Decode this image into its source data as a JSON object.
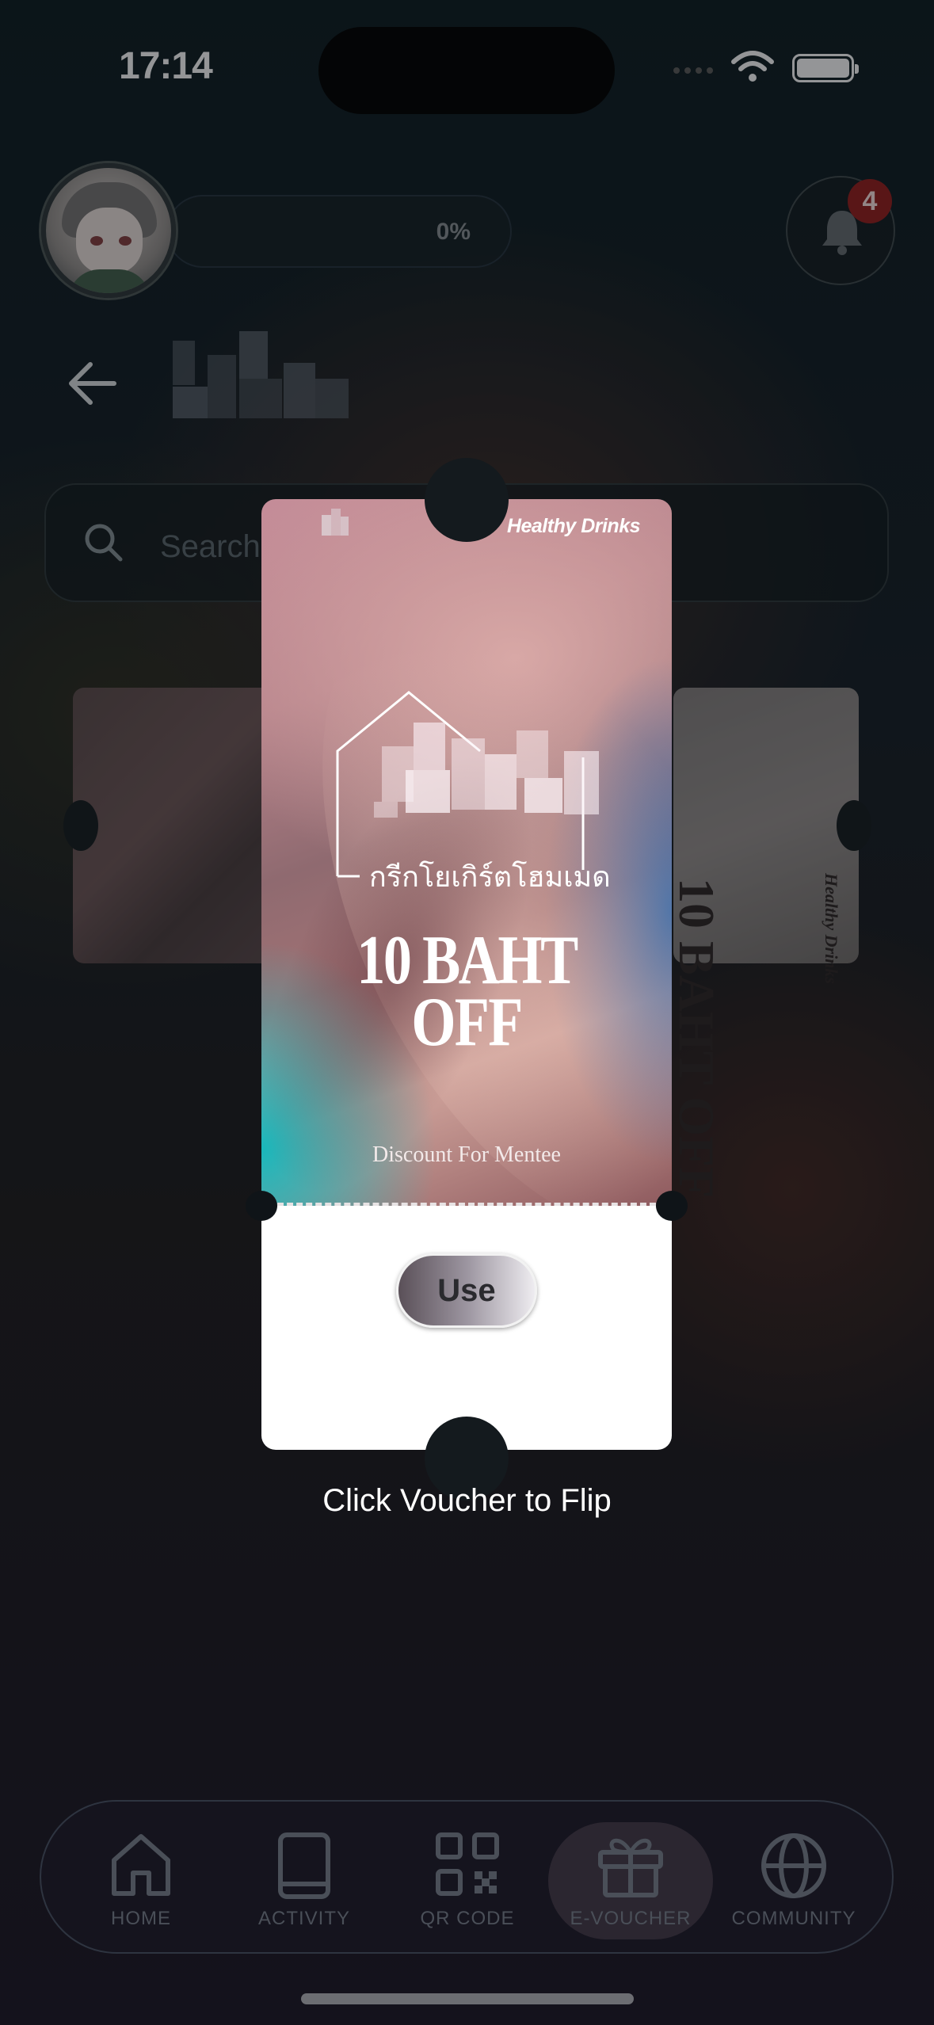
{
  "status_bar": {
    "time": "17:14"
  },
  "header": {
    "progress_text": "0%",
    "notification_count": "4"
  },
  "search": {
    "placeholder": "Search"
  },
  "side_voucher_right": {
    "deal": "10 BAHT OFF",
    "brand": "Healthy Drinks"
  },
  "voucher": {
    "brand": "Healthy Drinks",
    "thai_tagline": "กรีกโยเกิร์ตโฮมเมด",
    "deal_line1": "10 BAHT",
    "deal_line2": "OFF",
    "description": "Discount For Mentee",
    "use_label": "Use"
  },
  "flip_hint": "Click Voucher to Flip",
  "nav": {
    "items": [
      {
        "label": "HOME",
        "icon": "home-icon"
      },
      {
        "label": "ACTIVITY",
        "icon": "book-icon"
      },
      {
        "label": "QR CODE",
        "icon": "qr-code-icon"
      },
      {
        "label": "E-VOUCHER",
        "icon": "gift-icon",
        "active": true
      },
      {
        "label": "COMMUNITY",
        "icon": "globe-icon"
      }
    ]
  },
  "colors": {
    "badge": "#8a1c1c",
    "overlay": "#0a0c10",
    "voucher_bottom": "#ffffff"
  }
}
